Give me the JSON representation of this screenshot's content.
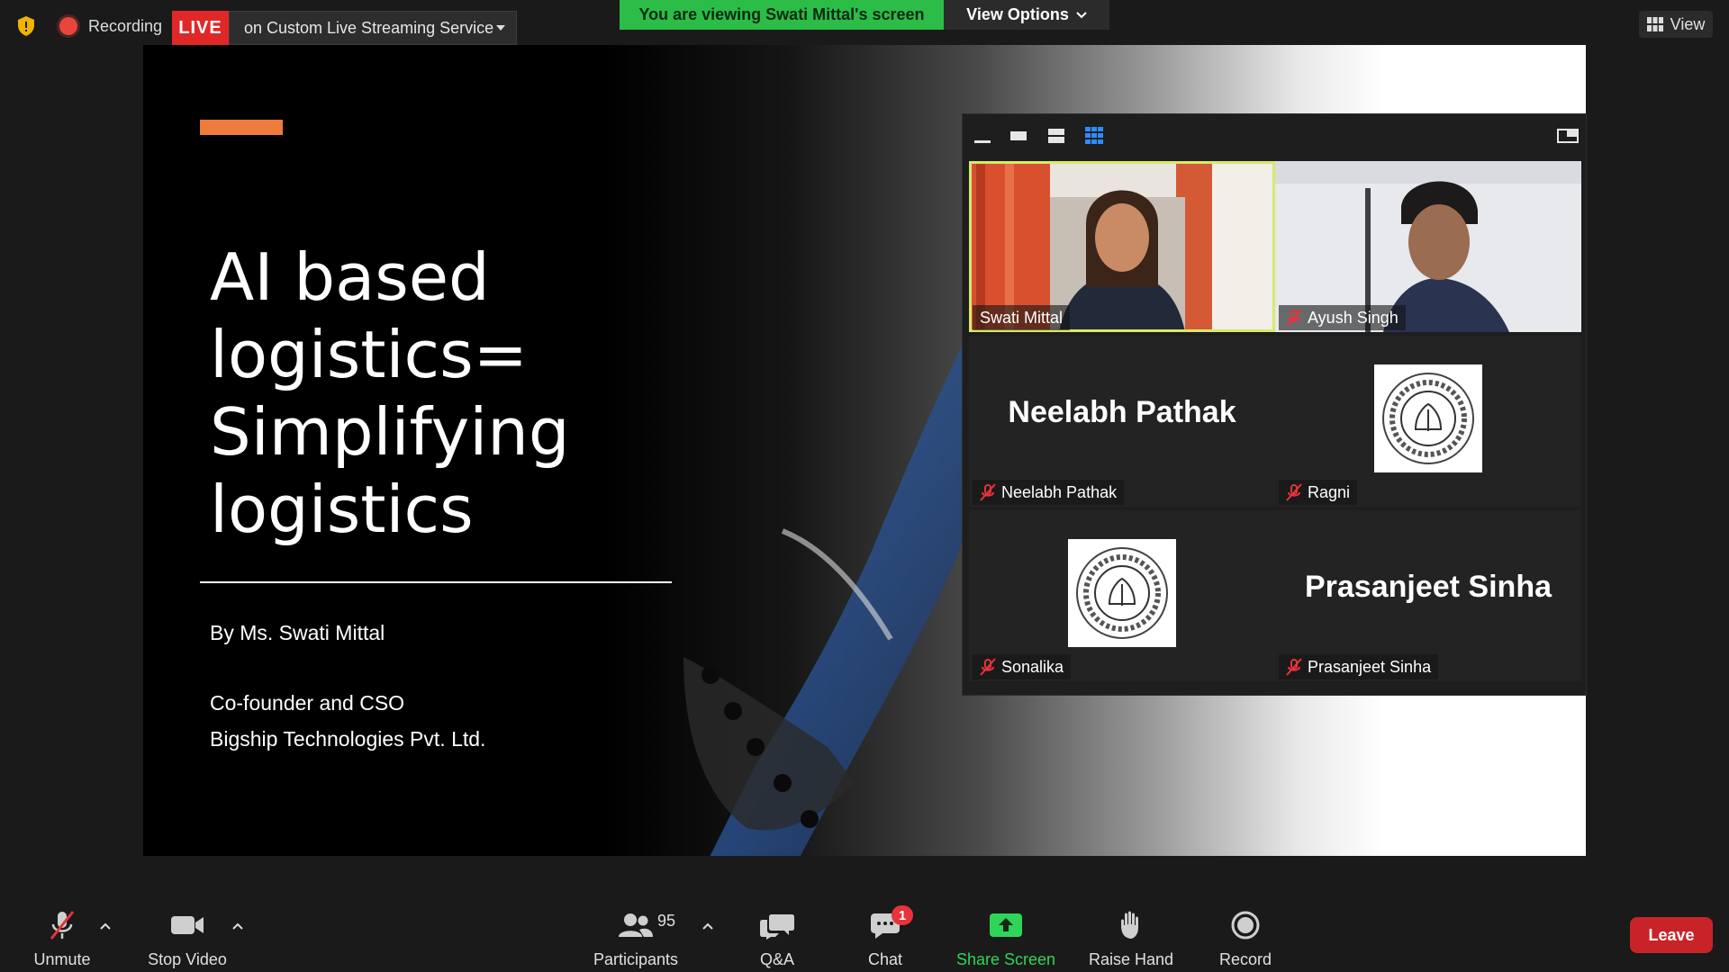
{
  "top": {
    "recording_label": "Recording",
    "live_label": "LIVE",
    "stream_service": "on Custom Live Streaming Service",
    "viewing_banner": "You are viewing Swati Mittal's screen",
    "view_options_label": "View Options",
    "view_label": "View"
  },
  "slide": {
    "title_lines": [
      "AI based",
      "logistics=",
      "Simplifying",
      "logistics"
    ],
    "byline": "By Ms. Swati Mittal",
    "role": "Co-founder and CSO",
    "company": "Bigship Technologies Pvt. Ltd."
  },
  "gallery": {
    "participants": [
      {
        "name": "Swati Mittal",
        "muted": false,
        "video": true,
        "active_speaker": true
      },
      {
        "name": "Ayush Singh",
        "muted": true,
        "video": true
      },
      {
        "name": "Neelabh Pathak",
        "muted": true,
        "video": false,
        "display": "Neelabh Pathak"
      },
      {
        "name": "Ragni",
        "muted": true,
        "video": false,
        "avatar": "logo"
      },
      {
        "name": "Sonalika",
        "muted": true,
        "video": false,
        "avatar": "logo"
      },
      {
        "name": "Prasanjeet Sinha",
        "muted": true,
        "video": false,
        "display": "Prasanjeet Sinha"
      }
    ]
  },
  "toolbar": {
    "unmute_label": "Unmute",
    "stop_video_label": "Stop Video",
    "participants_label": "Participants",
    "participants_count": "95",
    "qa_label": "Q&A",
    "chat_label": "Chat",
    "chat_badge": "1",
    "share_screen_label": "Share Screen",
    "raise_hand_label": "Raise Hand",
    "record_label": "Record",
    "leave_label": "Leave"
  },
  "colors": {
    "live": "#e02828",
    "banner": "#2bbd48",
    "share": "#2fd55a",
    "leave": "#c9232a",
    "active_speaker": "#d9e86a",
    "accent_bar": "#ee7a3b"
  }
}
